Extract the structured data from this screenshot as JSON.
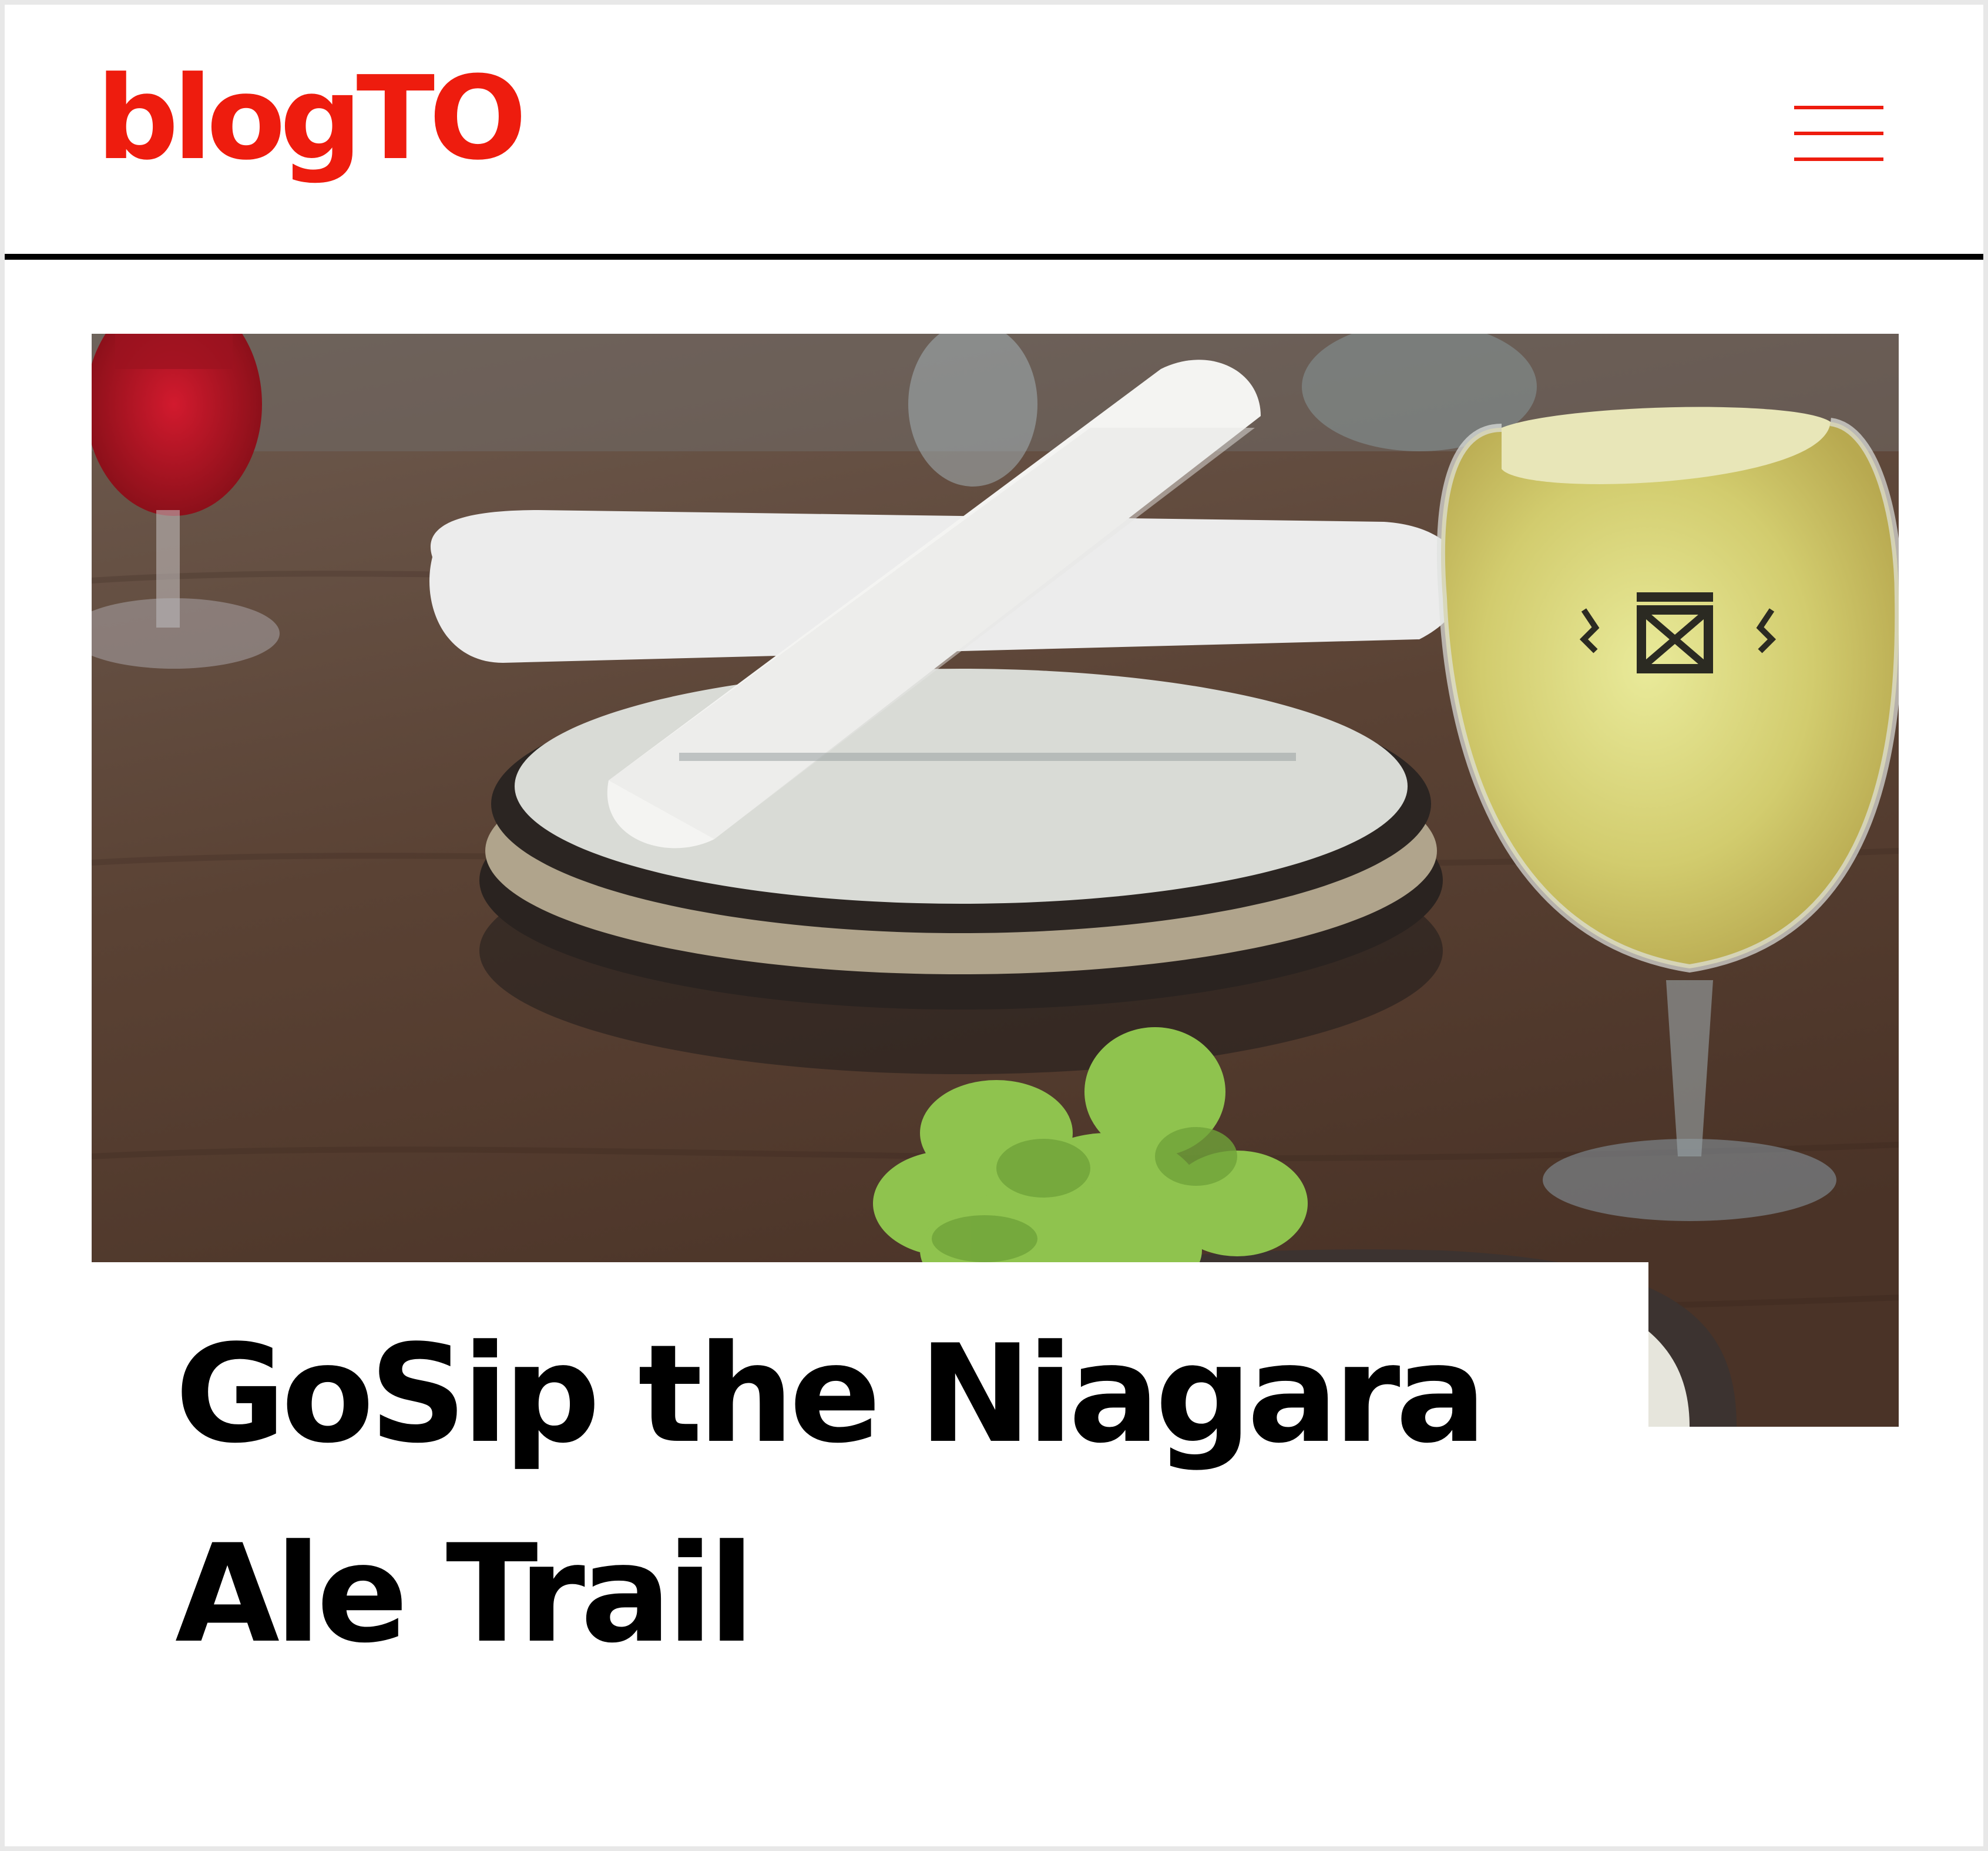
{
  "header": {
    "logo_text": "blogTO",
    "menu_icon": "hamburger-menu-icon",
    "accent_color": "#ee1c0e"
  },
  "article": {
    "image_subject": "glass of beer beside stacked plates with folded napkin and a garnish",
    "title": "GoSip the Niagara Ale Trail"
  }
}
